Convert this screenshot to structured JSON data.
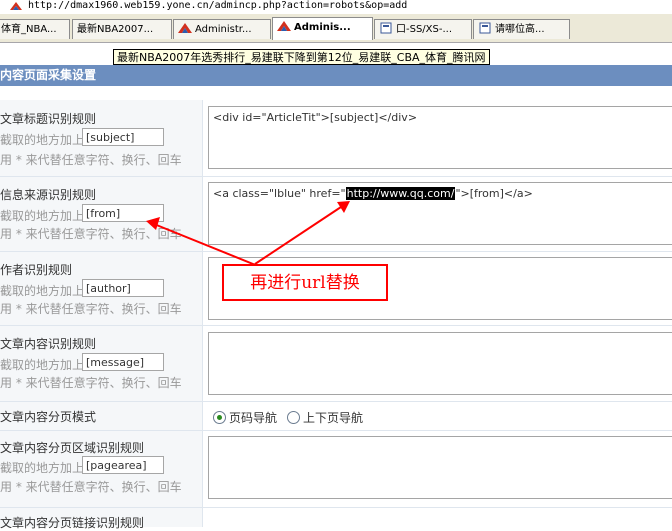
{
  "address_bar": {
    "url": "http://dmax1960.web159.yone.cn/admincp.php?action=robots&op=add"
  },
  "tabs": [
    {
      "label": "体育_NBA..."
    },
    {
      "label": "最新NBA2007..."
    },
    {
      "label": "Administr..."
    },
    {
      "label": "Adminis..."
    },
    {
      "label": "口-SS/XS-..."
    },
    {
      "label": "请哪位高..."
    }
  ],
  "tooltip": "最新NBA2007年选秀排行_易建联下降到第12位_易建联_CBA_体育_腾讯网",
  "section_header": "内容页面采集设置",
  "form": {
    "rows": [
      {
        "title": "文章标题识别规则",
        "hint1": "截取的地方加上",
        "tag": "[subject]",
        "hint2": "用 * 来代替任意字符、换行、回车",
        "value": "<div id=\"ArticleTit\">[subject]</div>"
      },
      {
        "title": "信息来源识别规则",
        "hint1": "截取的地方加上",
        "tag": "[from]",
        "hint2": "用 * 来代替任意字符、换行、回车",
        "value_pre": "<a class=\"lblue\" href=\"",
        "value_highlight": "http://www.qq.com/",
        "value_post": "\">[from]</a>"
      },
      {
        "title": "作者识别规则",
        "hint1": "截取的地方加上",
        "tag": "[author]",
        "hint2": "用 * 来代替任意字符、换行、回车",
        "value": ""
      },
      {
        "title": "文章内容识别规则",
        "hint1": "截取的地方加上",
        "tag": "[message]",
        "hint2": "用 * 来代替任意字符、换行、回车",
        "value": ""
      },
      {
        "title": "文章内容分页模式"
      },
      {
        "title": "文章内容分页区域识别规则",
        "hint1": "截取的地方加上",
        "tag": "[pagearea]",
        "hint2": "用 * 来代替任意字符、换行、回车",
        "value": ""
      },
      {
        "title": "文章内容分页链接识别规则"
      }
    ],
    "pagination_options": [
      {
        "label": "页码导航",
        "selected": true
      },
      {
        "label": "上下页导航",
        "selected": false
      }
    ]
  },
  "annotation": {
    "text": "再进行url替换",
    "color": "#ff0000"
  },
  "colors": {
    "header_bg": "#6c8ebf",
    "tooltip_bg": "#ffffe1",
    "label_bg": "#f5f7f9"
  }
}
